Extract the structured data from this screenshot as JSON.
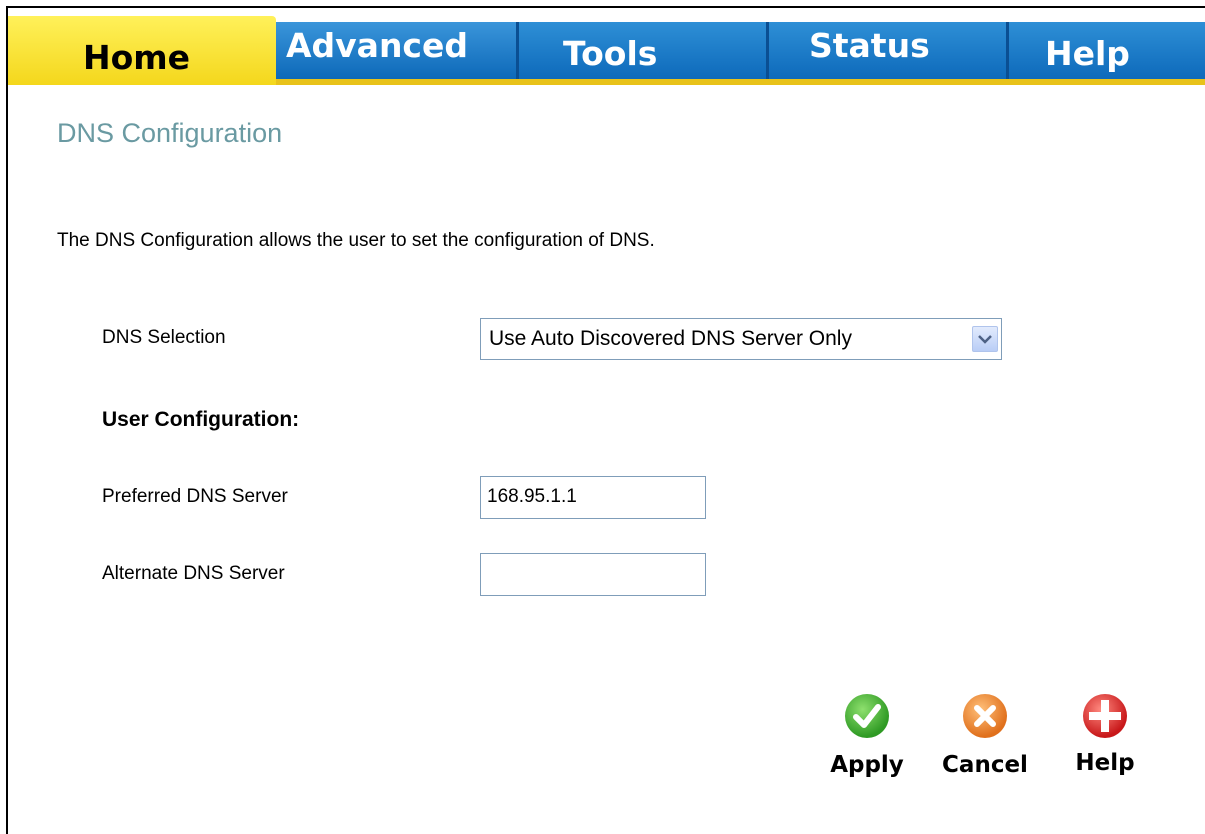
{
  "tabs": {
    "home": "Home",
    "advanced": "Advanced",
    "tools": "Tools",
    "status": "Status",
    "help": "Help"
  },
  "page": {
    "title": "DNS Configuration",
    "description": "The DNS Configuration allows the user to set the configuration of DNS."
  },
  "form": {
    "dns_selection_label": "DNS Selection",
    "dns_selection_value": "Use Auto Discovered DNS Server Only",
    "user_config_heading": "User Configuration:",
    "preferred_label": "Preferred DNS Server",
    "preferred_value": "168.95.1.1",
    "alternate_label": "Alternate DNS Server",
    "alternate_value": ""
  },
  "actions": {
    "apply": "Apply",
    "cancel": "Cancel",
    "help": "Help"
  },
  "colors": {
    "title": "#6a9aa2",
    "tab_active": "#f4d71c",
    "tab_bar": "#0a66b8"
  },
  "icons": {
    "apply": "check-icon",
    "cancel": "x-icon",
    "help": "plus-icon",
    "dropdown": "chevron-down-icon"
  }
}
